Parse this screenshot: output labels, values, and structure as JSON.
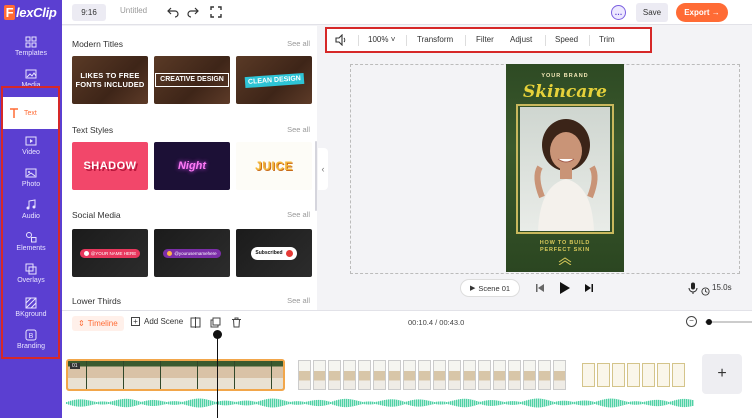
{
  "app": {
    "logo_text": "FlexClip",
    "logo_letter": "F",
    "logo_rest": "lexClip"
  },
  "topbar": {
    "aspect_ratio": "9:16",
    "document_title": "Untitled",
    "chat_icon_glyph": "…",
    "save_label": "Save",
    "export_label": "Export →"
  },
  "sidebar": {
    "items": [
      {
        "label": "Templates",
        "icon": "templates-icon"
      },
      {
        "label": "Media",
        "icon": "media-icon"
      },
      {
        "label": "Text",
        "icon": "text-icon",
        "active": true
      },
      {
        "label": "Video",
        "icon": "video-icon"
      },
      {
        "label": "Photo",
        "icon": "photo-icon"
      },
      {
        "label": "Audio",
        "icon": "audio-icon"
      },
      {
        "label": "Elements",
        "icon": "elements-icon"
      },
      {
        "label": "Overlays",
        "icon": "overlays-icon"
      },
      {
        "label": "BKground",
        "icon": "background-icon"
      },
      {
        "label": "Branding",
        "icon": "branding-icon"
      }
    ]
  },
  "panel": {
    "see_all": "See all",
    "sections": [
      {
        "title": "Modern Titles",
        "thumbs": [
          "LIKES TO FREE FONTS INCLUDED",
          "CREATIVE DESIGN",
          "CLEAN DESIGN"
        ]
      },
      {
        "title": "Text Styles",
        "thumbs": [
          "SHADOW",
          "Night",
          "JUICE"
        ]
      },
      {
        "title": "Social Media",
        "thumbs": [
          "@YOUR NAME HERE",
          "@yourusernamehere",
          "Subscribed"
        ]
      },
      {
        "title": "Lower Thirds",
        "thumbs": []
      }
    ]
  },
  "edit_toolbar": {
    "zoom": "100%",
    "items": [
      "Transform",
      "Filter",
      "Adjust",
      "Speed",
      "Trim"
    ]
  },
  "canvas": {
    "brand": "YOUR BRAND",
    "headline": "Skincare",
    "tagline_line1": "HOW TO BUILD",
    "tagline_line2": "PERFECT SKIN"
  },
  "playback": {
    "scene_label": "Scene 01",
    "duration": "15.0s"
  },
  "timeline": {
    "label": "Timeline",
    "add_scene": "Add Scene",
    "time_readout": "00:10.4 / 00:43.0",
    "clip1_badge": "01",
    "add_clip": "+",
    "zoom_out": "−"
  },
  "colors": {
    "sidebar": "#5b3fd1",
    "accent": "#ff6b35",
    "highlight": "#d62828"
  }
}
